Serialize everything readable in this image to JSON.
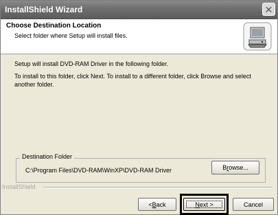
{
  "window": {
    "title": "InstallShield Wizard"
  },
  "header": {
    "title": "Choose Destination Location",
    "subtitle": "Select folder where Setup will install files."
  },
  "body": {
    "intro": "Setup will install DVD-RAM Driver in the following folder.",
    "instructions": "To install to this folder, click Next. To install to a different folder, click Browse and select another folder."
  },
  "destination": {
    "group_label": "Destination Folder",
    "path": "C:\\Program Files\\DVD-RAM\\WinXP\\DVD-RAM Driver",
    "browse_label_pre": "B",
    "browse_label_accel": "r",
    "browse_label_post": "owse..."
  },
  "footer": {
    "brand": "InstallShield",
    "back_label_pre": "< ",
    "back_label_accel": "B",
    "back_label_post": "ack",
    "next_label_accel": "N",
    "next_label_post": "ext >",
    "cancel_label": "Cancel"
  },
  "icons": {
    "close": "close-icon",
    "header": "install-computer-icon"
  },
  "colors": {
    "dialog_bg": "#ece9d8",
    "titlebar": "#6e6e6e",
    "highlight_box": "#000000"
  }
}
